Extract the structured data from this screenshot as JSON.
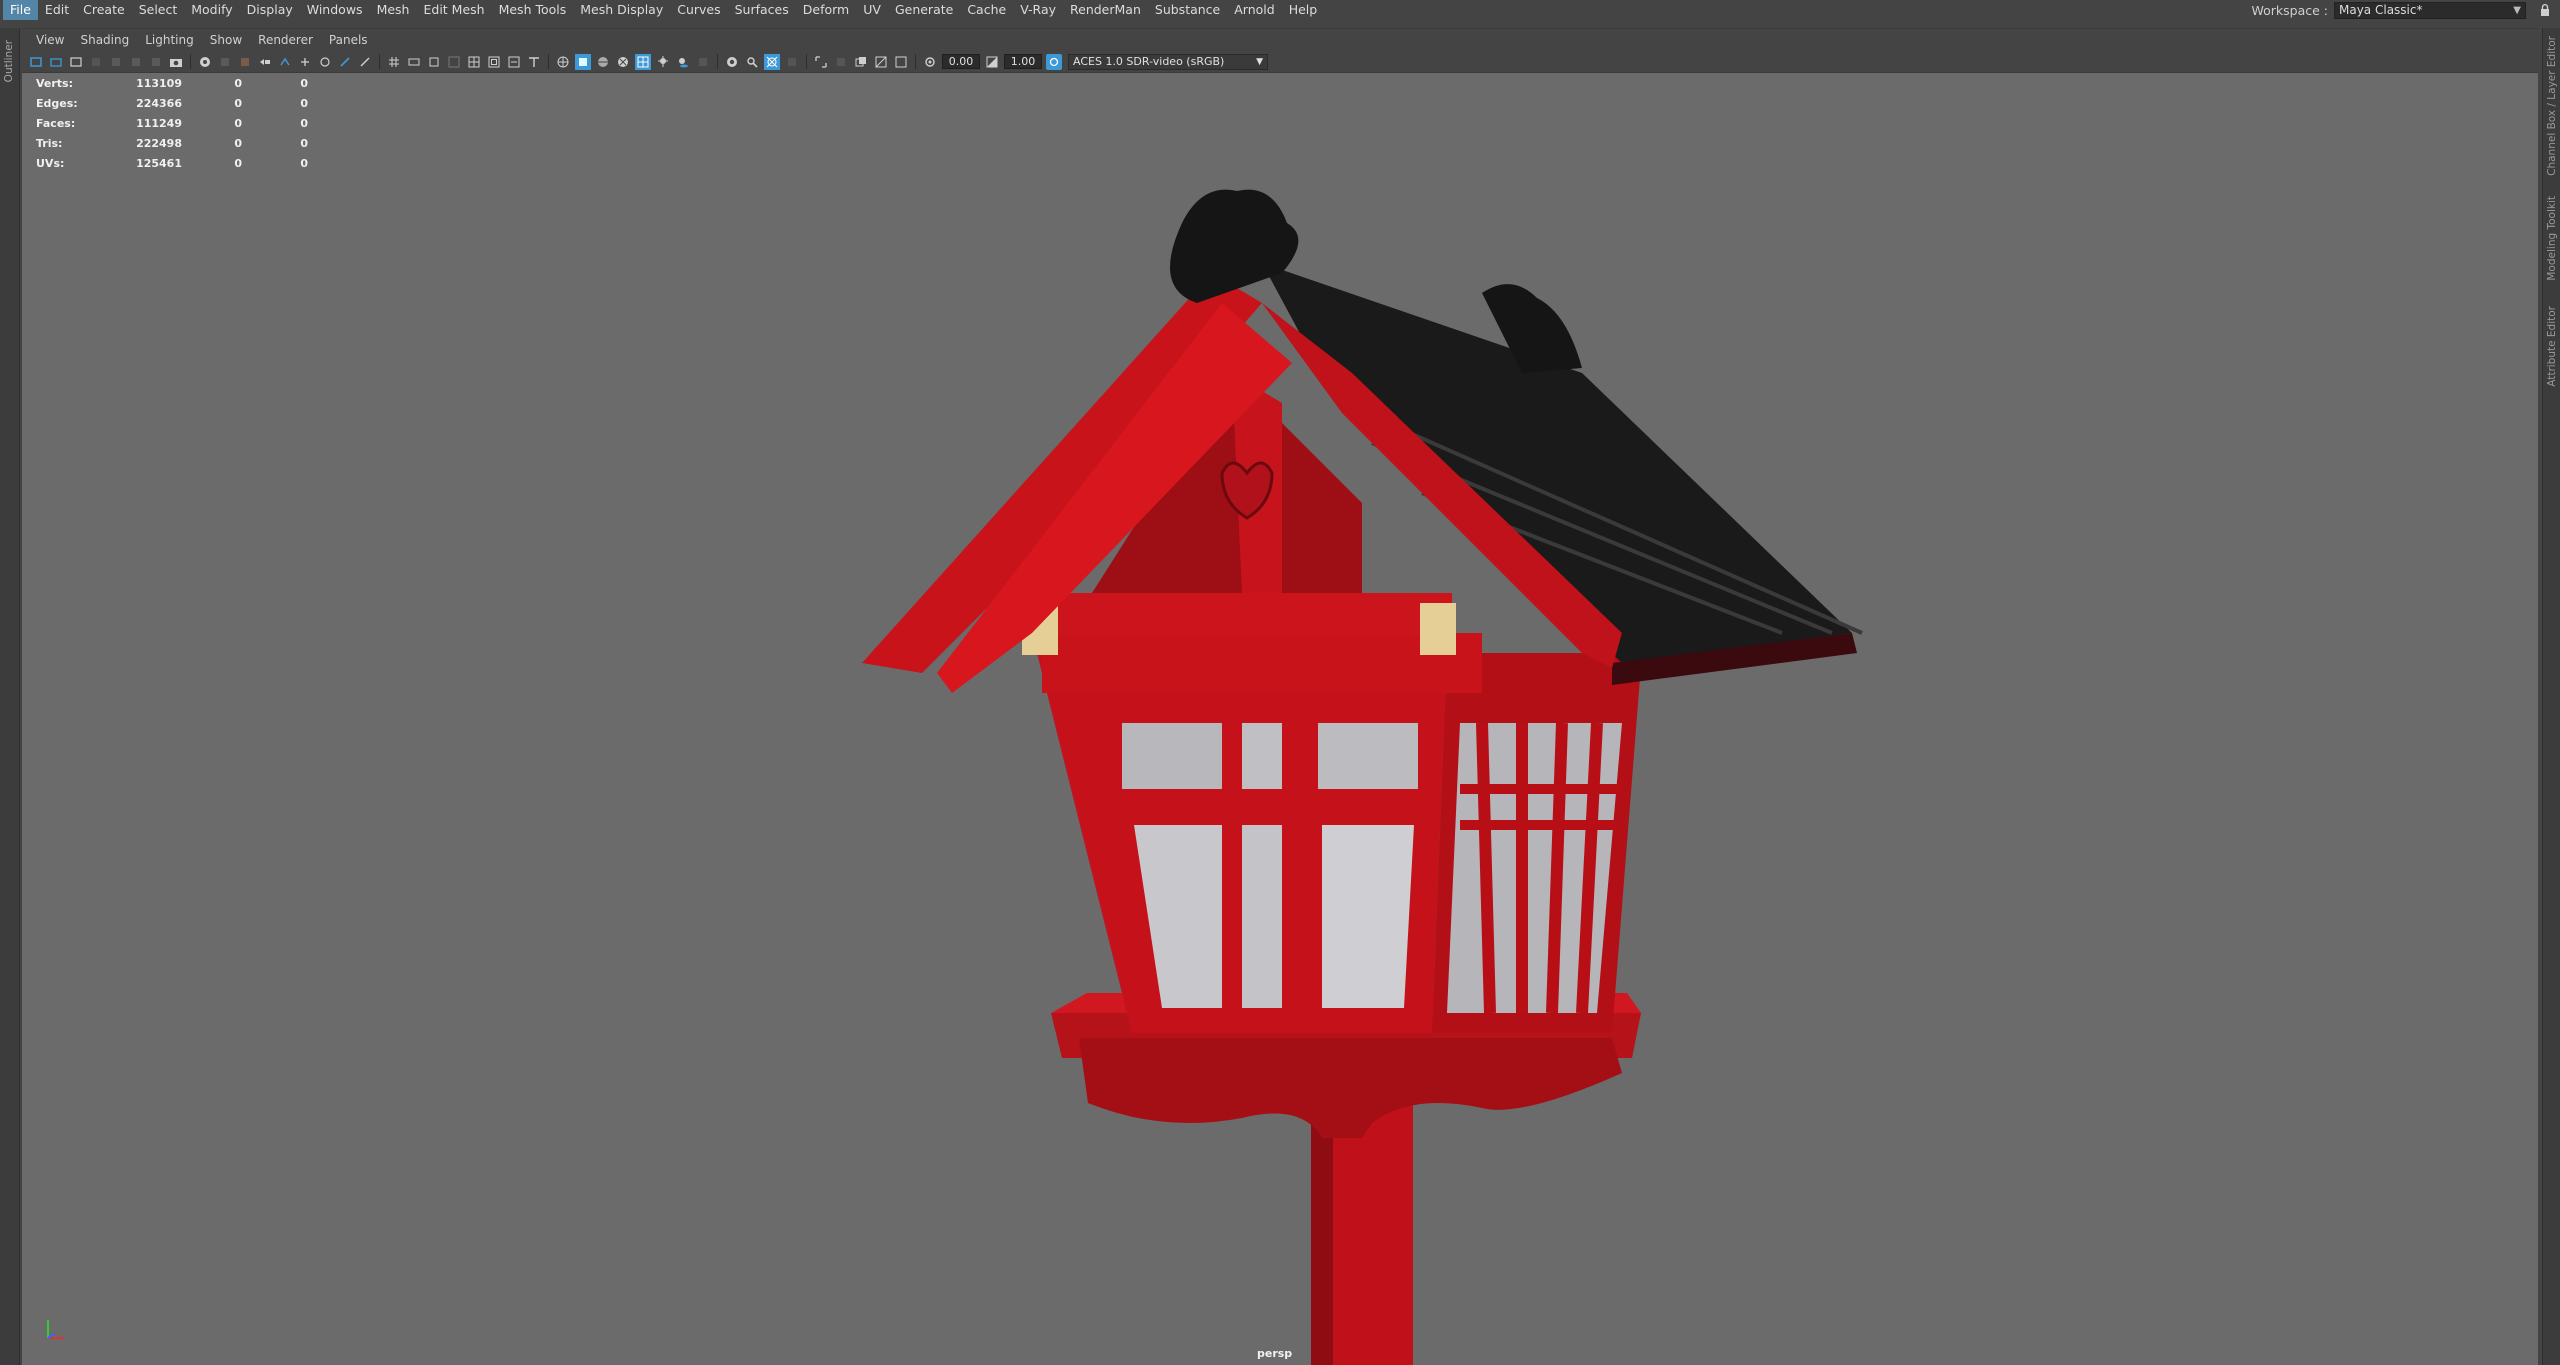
{
  "menu": {
    "items": [
      "File",
      "Edit",
      "Create",
      "Select",
      "Modify",
      "Display",
      "Windows",
      "Mesh",
      "Edit Mesh",
      "Mesh Tools",
      "Mesh Display",
      "Curves",
      "Surfaces",
      "Deform",
      "UV",
      "Generate",
      "Cache",
      "V-Ray",
      "RenderMan",
      "Substance",
      "Arnold",
      "Help"
    ],
    "active": "File"
  },
  "workspace": {
    "label": "Workspace :",
    "value": "Maya Classic*"
  },
  "left_strip": {
    "outliner_tab": "Outliner"
  },
  "right_strip": {
    "tabs": [
      "Channel Box / Layer Editor",
      "Modeling Toolkit",
      "Attribute Editor"
    ]
  },
  "panel_menu": {
    "items": [
      "View",
      "Shading",
      "Lighting",
      "Show",
      "Renderer",
      "Panels"
    ]
  },
  "panel_toolbar": {
    "exposure": "0.00",
    "gamma": "1.00",
    "color_management": "ACES 1.0 SDR-video (sRGB)"
  },
  "hud": {
    "rows": [
      {
        "label": "Verts:",
        "v1": "113109",
        "v2": "0",
        "v3": "0"
      },
      {
        "label": "Edges:",
        "v1": "224366",
        "v2": "0",
        "v3": "0"
      },
      {
        "label": "Faces:",
        "v1": "111249",
        "v2": "0",
        "v3": "0"
      },
      {
        "label": "Tris:",
        "v1": "222498",
        "v2": "0",
        "v3": "0"
      },
      {
        "label": "UVs:",
        "v1": "125461",
        "v2": "0",
        "v3": "0"
      }
    ]
  },
  "viewport": {
    "camera": "persp"
  },
  "colors": {
    "menu_active": "#5285a6",
    "viewport_bg": "#6b6b6b",
    "lantern_red": "#c8121b",
    "roof_black": "#1c1c1c",
    "accent_blue": "#3d9ad6"
  }
}
